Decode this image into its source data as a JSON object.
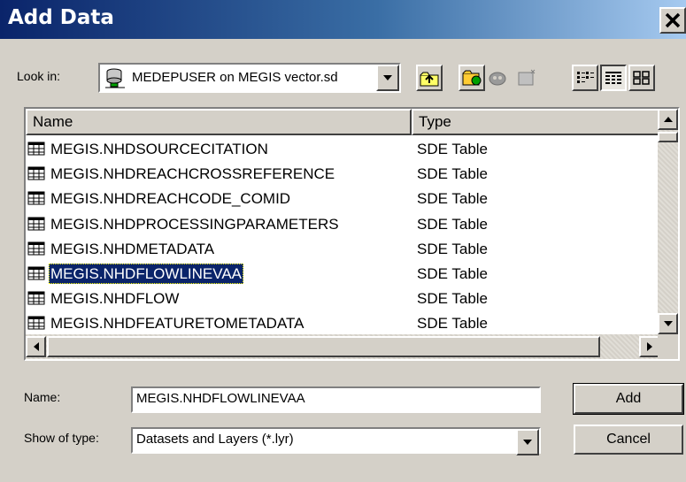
{
  "window": {
    "title": "Add Data"
  },
  "toolbar": {
    "look_in_label": "Look in:",
    "look_in_value": "MEDEPUSER on MEGIS vector.sd",
    "buttons": [
      {
        "name": "up-one-level-button",
        "icon": "folder-up-icon"
      },
      {
        "name": "connect-to-folder-button",
        "icon": "connect-folder-icon"
      },
      {
        "name": "disconnect-folder-button",
        "icon": "disconnect-folder-icon"
      },
      {
        "name": "new-item-button",
        "icon": "new-item-icon"
      },
      {
        "name": "list-view-button",
        "icon": "list-view-icon"
      },
      {
        "name": "details-view-button",
        "icon": "details-view-icon"
      },
      {
        "name": "thumbnails-view-button",
        "icon": "thumbnails-view-icon"
      }
    ]
  },
  "list": {
    "columns": [
      "Name",
      "Type"
    ],
    "rows": [
      {
        "name": "MEGIS.NHDSOURCECITATION",
        "type": "SDE Table",
        "selected": false
      },
      {
        "name": "MEGIS.NHDREACHCROSSREFERENCE",
        "type": "SDE Table",
        "selected": false
      },
      {
        "name": "MEGIS.NHDREACHCODE_COMID",
        "type": "SDE Table",
        "selected": false
      },
      {
        "name": "MEGIS.NHDPROCESSINGPARAMETERS",
        "type": "SDE Table",
        "selected": false
      },
      {
        "name": "MEGIS.NHDMETADATA",
        "type": "SDE Table",
        "selected": false
      },
      {
        "name": "MEGIS.NHDFLOWLINEVAA",
        "type": "SDE Table",
        "selected": true
      },
      {
        "name": "MEGIS.NHDFLOW",
        "type": "SDE Table",
        "selected": false
      },
      {
        "name": "MEGIS.NHDFEATURETOMETADATA",
        "type": "SDE Table",
        "selected": false
      }
    ]
  },
  "form": {
    "name_label": "Name:",
    "name_value": "MEGIS.NHDFLOWLINEVAA",
    "show_label": "Show of type:",
    "show_value": "Datasets and Layers (*.lyr)"
  },
  "buttons": {
    "add": "Add",
    "cancel": "Cancel"
  },
  "colors": {
    "title_start": "#0a246a",
    "title_end": "#a6caf0",
    "selection": "#0a246a",
    "face": "#d4d0c8"
  }
}
